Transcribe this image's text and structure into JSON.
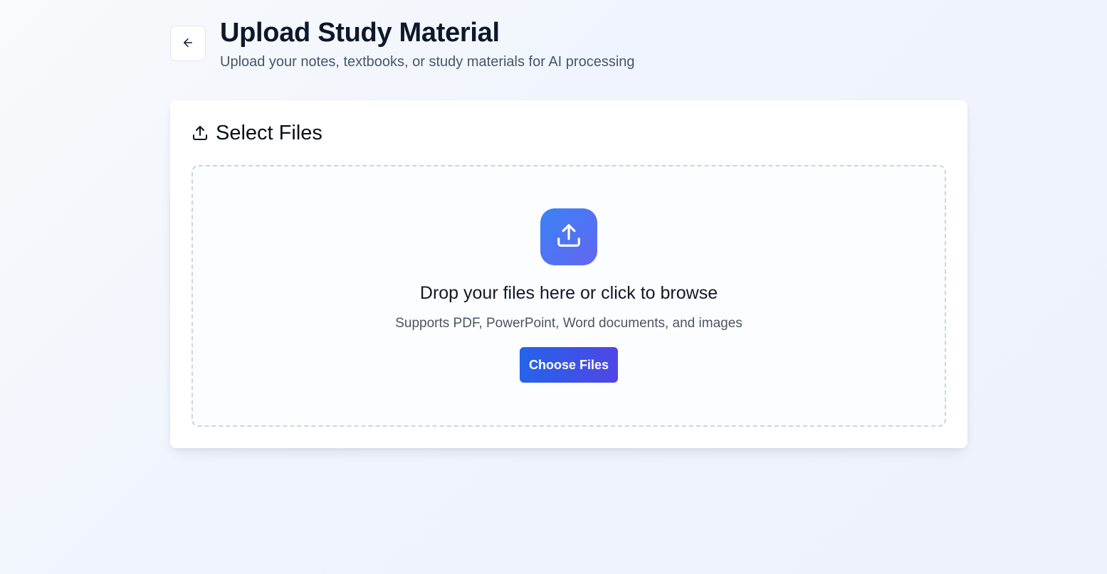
{
  "header": {
    "title": "Upload Study Material",
    "subtitle": "Upload your notes, textbooks, or study materials for AI processing",
    "back_icon": "arrow-left-icon"
  },
  "card": {
    "title": "Select Files",
    "title_icon": "upload-icon"
  },
  "dropzone": {
    "icon": "upload-icon",
    "title": "Drop your files here or click to browse",
    "subtitle": "Supports PDF, PowerPoint, Word documents, and images",
    "button_label": "Choose Files"
  },
  "colors": {
    "accent_start": "#3b82f6",
    "accent_end": "#4f46e5",
    "title_text": "#0f172a",
    "muted_text": "#475569"
  }
}
